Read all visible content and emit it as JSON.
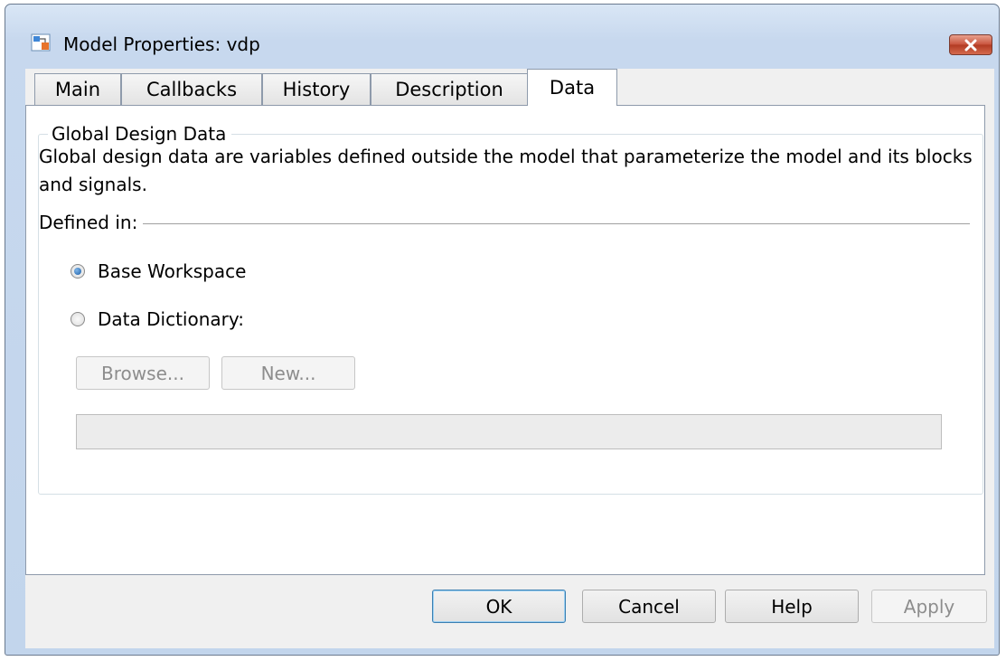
{
  "window": {
    "title": "Model Properties: vdp",
    "close_icon": "close-icon",
    "app_icon": "simulink-model-icon"
  },
  "tabs": [
    {
      "label": "Main",
      "active": false
    },
    {
      "label": "Callbacks",
      "active": false
    },
    {
      "label": "History",
      "active": false
    },
    {
      "label": "Description",
      "active": false
    },
    {
      "label": "Data",
      "active": true
    }
  ],
  "group": {
    "legend": "Global Design Data",
    "description": "Global design data are variables defined outside the model that parameterize the model and its blocks and signals.",
    "defined_in_label": "Defined in:",
    "options": [
      {
        "label": "Base Workspace",
        "checked": true
      },
      {
        "label": "Data Dictionary:",
        "checked": false
      }
    ],
    "browse_label": "Browse...",
    "new_label": "New...",
    "dictionary_path": ""
  },
  "footer": {
    "ok_label": "OK",
    "cancel_label": "Cancel",
    "help_label": "Help",
    "apply_label": "Apply"
  },
  "colors": {
    "accent": "#3c7fb1",
    "close_button": "#c8523b",
    "disabled_text": "#8d8d8d"
  }
}
